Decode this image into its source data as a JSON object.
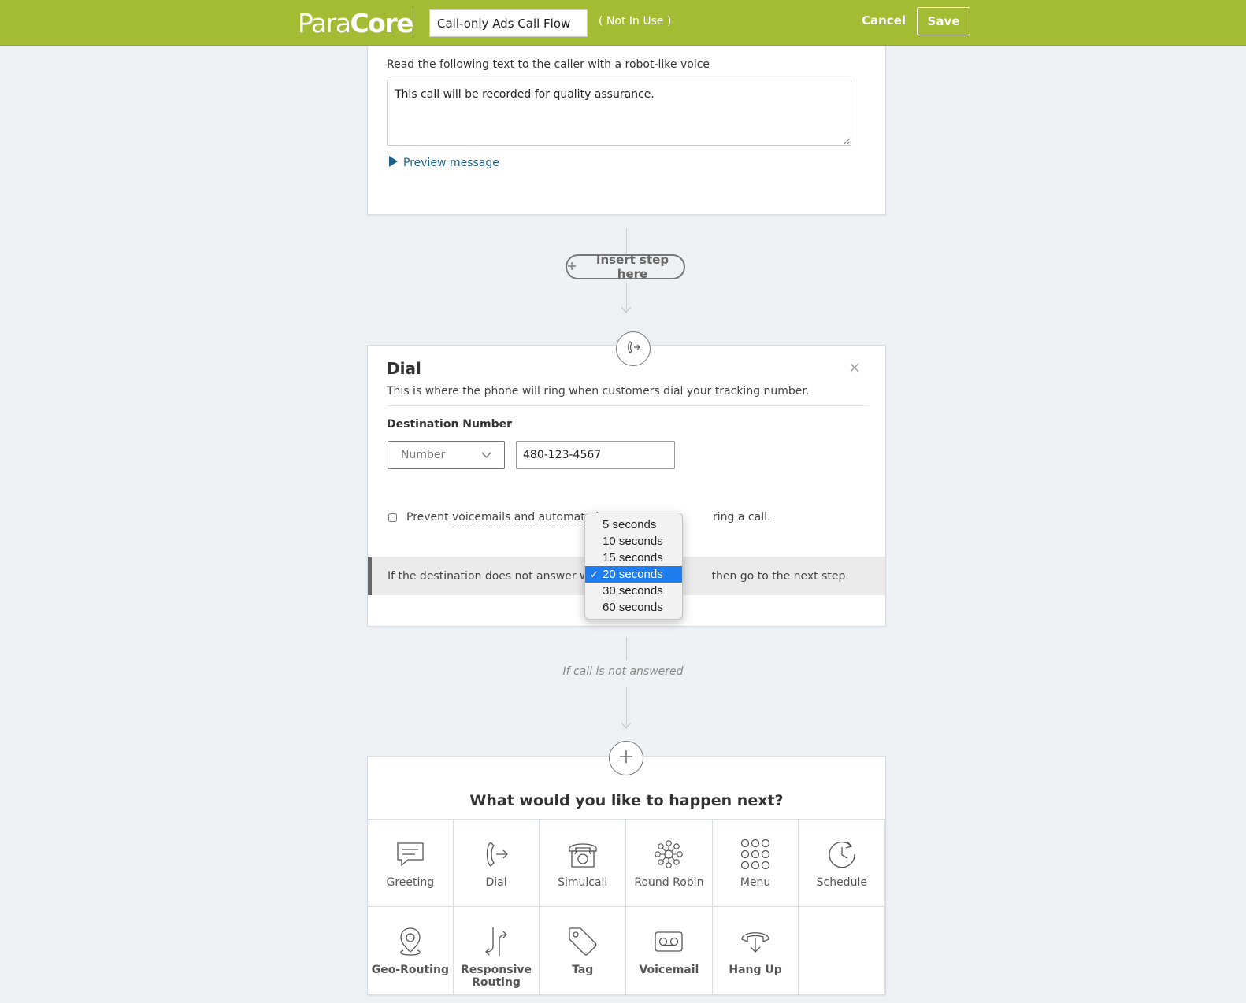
{
  "header": {
    "logo_part1": "Para",
    "logo_part2": "Core",
    "flow_name": "Call-only Ads Call Flow",
    "status": "( Not In Use )",
    "cancel_label": "Cancel",
    "save_label": "Save"
  },
  "greeting_step": {
    "label": "Read the following text to the caller with a robot-like voice",
    "message": "This call will be recorded for quality assurance.",
    "preview_label": "Preview message"
  },
  "insert_step_label": "Insert step here",
  "dial_step": {
    "title": "Dial",
    "description": "This is where the phone will ring when customers dial your tracking number.",
    "destination_label": "Destination Number",
    "destination_type": "Number",
    "destination_number": "480-123-4567",
    "prevent_prefix": "Prevent",
    "prevent_link": "voicemails and automated s",
    "prevent_suffix": "ring a call.",
    "timeout_prefix": "If the destination does not answer within",
    "timeout_suffix": "then go to the next step.",
    "timeout_options": [
      "5 seconds",
      "10 seconds",
      "15 seconds",
      "20 seconds",
      "30 seconds",
      "60 seconds"
    ],
    "timeout_selected": "20 seconds"
  },
  "not_answered_label": "If call is not answered",
  "next_step": {
    "title": "What would you like to happen next?",
    "options": [
      {
        "label": "Greeting",
        "icon": "greeting-icon"
      },
      {
        "label": "Dial",
        "icon": "dial-icon"
      },
      {
        "label": "Simulcall",
        "icon": "simulcall-icon"
      },
      {
        "label": "Round Robin",
        "icon": "round-robin-icon"
      },
      {
        "label": "Menu",
        "icon": "menu-icon"
      },
      {
        "label": "Schedule",
        "icon": "schedule-icon"
      },
      {
        "label": "Geo-Routing",
        "icon": "geo-routing-icon"
      },
      {
        "label": "Responsive Routing",
        "icon": "responsive-routing-icon"
      },
      {
        "label": "Tag",
        "icon": "tag-icon"
      },
      {
        "label": "Voicemail",
        "icon": "voicemail-icon"
      },
      {
        "label": "Hang Up",
        "icon": "hang-up-icon"
      }
    ]
  },
  "colors": {
    "header_bg": "#a3bc33",
    "link": "#1c5f8a",
    "selected_option": "#1f7df0"
  }
}
